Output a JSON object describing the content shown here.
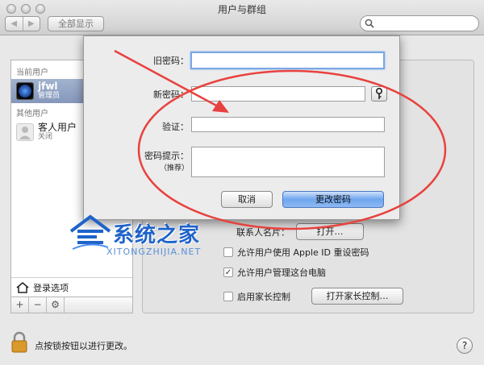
{
  "window": {
    "title": "用户与群组",
    "nav_back": "◀",
    "nav_forward": "▶",
    "show_all": "全部显示",
    "search_placeholder": ""
  },
  "sidebar": {
    "current_header": "当前用户",
    "current_user": {
      "name": "jfwl",
      "role": "管理员"
    },
    "other_header": "其他用户",
    "guest_user": {
      "name": "客人用户",
      "status": "关闭"
    },
    "login_options": "登录选项",
    "add": "+",
    "remove": "−",
    "gear": "⚙"
  },
  "sheet": {
    "old_password_label": "旧密码：",
    "new_password_label": "新密码：",
    "verify_label": "验证：",
    "hint_label": "密码提示：",
    "hint_sub": "（推荐）",
    "cancel": "取消",
    "change_password": "更改密码"
  },
  "main": {
    "contact_card_label": "联系人名片：",
    "open_button": "打开…",
    "allow_apple_id": "允许用户使用 Apple ID 重设密码",
    "allow_admin": "允许用户管理这台电脑",
    "allow_admin_check": "✓",
    "parental": "启用家长控制",
    "open_parental": "打开家长控制…"
  },
  "footer": {
    "lock_text": "点按锁按钮以进行更改。",
    "help": "?"
  },
  "watermark": {
    "cn": "系统之家",
    "en": "XITONGZHIJIA.NET"
  },
  "colors": {
    "annotation_red": "#e8423f",
    "accent_blue": "#6ea5ee",
    "selection": "#8598bb"
  }
}
